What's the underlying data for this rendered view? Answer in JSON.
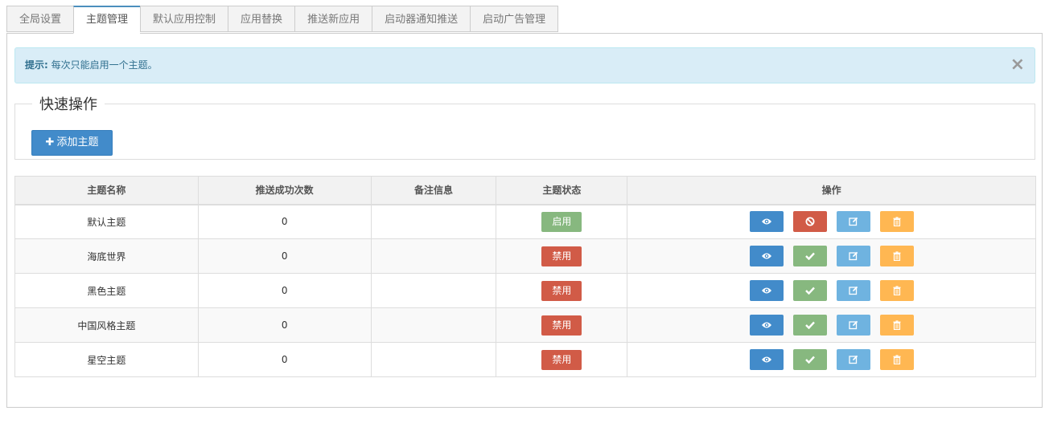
{
  "tabs": [
    {
      "label": "全局设置",
      "active": false
    },
    {
      "label": "主题管理",
      "active": true
    },
    {
      "label": "默认应用控制",
      "active": false
    },
    {
      "label": "应用替换",
      "active": false
    },
    {
      "label": "推送新应用",
      "active": false
    },
    {
      "label": "启动器通知推送",
      "active": false
    },
    {
      "label": "启动广告管理",
      "active": false
    }
  ],
  "alert": {
    "prefix": "提示:",
    "message": " 每次只能启用一个主题。",
    "close": "×"
  },
  "quick_ops": {
    "legend": "快速操作",
    "add_label": "添加主题"
  },
  "table": {
    "headers": [
      "主题名称",
      "推送成功次数",
      "备注信息",
      "主题状态",
      "操作"
    ],
    "rows": [
      {
        "name": "默认主题",
        "count": "0",
        "remark": "",
        "status": "启用",
        "enabled": true
      },
      {
        "name": "海底世界",
        "count": "0",
        "remark": "",
        "status": "禁用",
        "enabled": false
      },
      {
        "name": "黑色主题",
        "count": "0",
        "remark": "",
        "status": "禁用",
        "enabled": false
      },
      {
        "name": "中国风格主题",
        "count": "0",
        "remark": "",
        "status": "禁用",
        "enabled": false
      },
      {
        "name": "星空主题",
        "count": "0",
        "remark": "",
        "status": "禁用",
        "enabled": false
      }
    ]
  },
  "colors": {
    "primary": "#428bca",
    "success": "#87b87f",
    "danger": "#d15b47",
    "info": "#6fb3e0",
    "warning": "#ffb752"
  },
  "icons": {
    "view": "eye-icon",
    "disable": "ban-icon",
    "enable": "check-icon",
    "edit": "edit-icon",
    "delete": "trash-icon",
    "add": "plus-icon",
    "close": "close-icon"
  }
}
